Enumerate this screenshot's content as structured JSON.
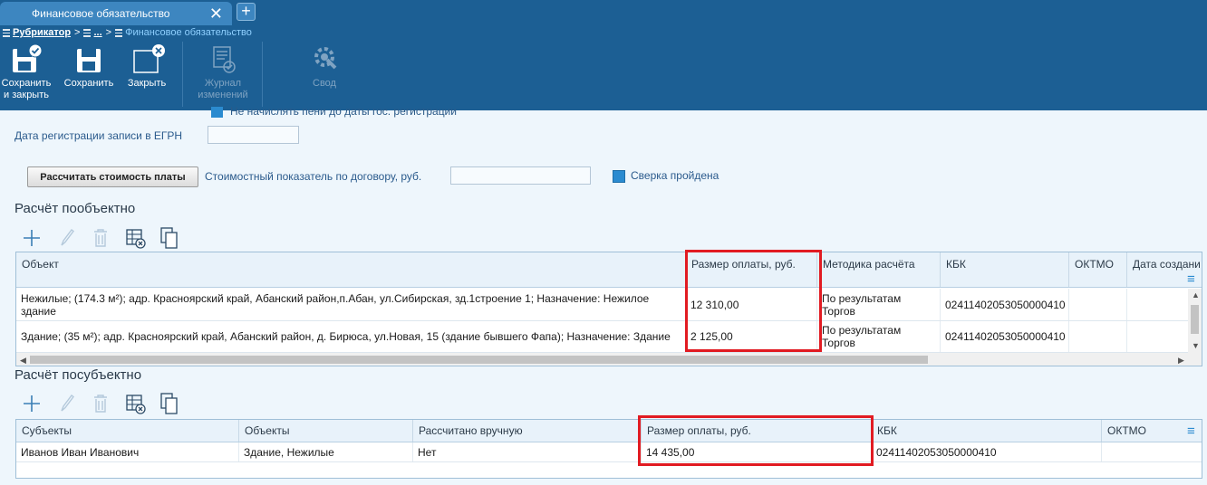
{
  "tabs": [
    {
      "label": "Финансовое обязательство"
    }
  ],
  "breadcrumb": {
    "root": "Рубрикатор",
    "middle": "...",
    "current": "Финансовое обязательство"
  },
  "toolbar": {
    "save_close_line1": "Сохранить",
    "save_close_line2": "и закрыть",
    "save": "Сохранить",
    "close": "Закрыть",
    "journal_line1": "Журнал",
    "journal_line2": "изменений",
    "summary": "Свод"
  },
  "form": {
    "truncated_checkbox_label": "Не начислять пени до даты гос. регистрации",
    "egrn_date_label": "Дата регистрации записи в ЕГРН",
    "egrn_date_value": "",
    "calc_button": "Рассчитать стоимость платы",
    "contract_value_label": "Стоимостный показатель по договору, руб.",
    "contract_value": "",
    "check_passed_label": "Сверка пройдена"
  },
  "per_object": {
    "title": "Расчёт пообъектно",
    "columns": [
      "Объект",
      "Размер оплаты, руб.",
      "Методика расчёта",
      "КБК",
      "ОКТМО",
      "Дата создани"
    ],
    "rows": [
      {
        "object": "Нежилые; (174.3 м²); адр. Красноярский край, Абанский район,п.Абан, ул.Сибирская, зд.1строение 1; Назначение: Нежилое здание",
        "amount": "12 310,00",
        "method": "По результатам Торгов",
        "kbk": "02411402053050000410",
        "oktmo": "",
        "created": ""
      },
      {
        "object": "Здание; (35 м²); адр. Красноярский край, Абанский район, д. Бирюса, ул.Новая, 15 (здание бывшего Фапа); Назначение: Здание",
        "amount": "2 125,00",
        "method": "По результатам Торгов",
        "kbk": "02411402053050000410",
        "oktmo": "",
        "created": ""
      }
    ]
  },
  "per_subject": {
    "title": "Расчёт посубъектно",
    "columns": [
      "Субъекты",
      "Объекты",
      "Рассчитано вручную",
      "Размер оплаты, руб.",
      "КБК",
      "ОКТМО"
    ],
    "rows": [
      {
        "subject": "Иванов Иван Иванович",
        "objects": "Здание, Нежилые",
        "manual": "Нет",
        "amount": "14 435,00",
        "kbk": "02411402053050000410",
        "oktmo": ""
      }
    ]
  },
  "colors": {
    "brand": "#1c5f94",
    "tab": "#3d86c0",
    "accent": "#2b8bd0",
    "highlight": "#e11b22"
  }
}
